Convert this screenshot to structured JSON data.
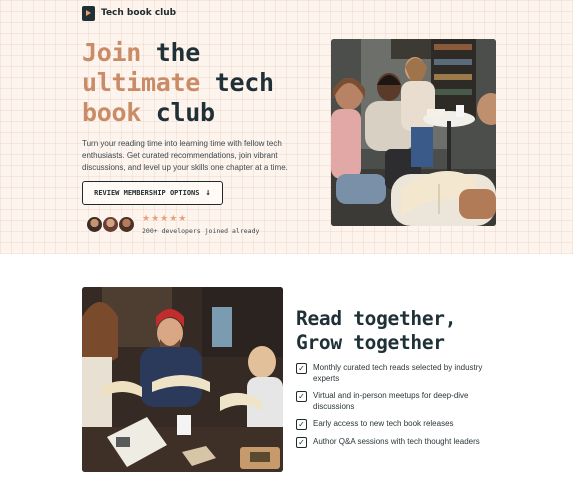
{
  "brand": {
    "name": "Tech book club",
    "logo_icon": "book-play-icon"
  },
  "hero": {
    "title_line1_accent": "Join",
    "title_line1_rest": " the",
    "title_line2_accent": "ultimate",
    "title_line2_rest": " tech",
    "title_line3_accent": "book",
    "title_line3_rest": " club",
    "description": "Turn your reading time into learning time with fellow tech enthusiasts. Get curated recommendations, join vibrant discussions, and level up your skills one chapter at a time.",
    "cta_label": "REVIEW MEMBERSHIP OPTIONS",
    "cta_icon": "arrow-down-icon",
    "stars": "★★★★★",
    "rating": 5,
    "joined_text": "200+ developers joined already"
  },
  "section2": {
    "title_line1": "Read together,",
    "title_line2": "Grow together",
    "features": [
      "Monthly curated tech reads selected by industry experts",
      "Virtual and in-person meetups for deep-dive discussions",
      "Early access to new tech book releases",
      "Author Q&A sessions with tech thought leaders"
    ]
  },
  "colors": {
    "accent": "#c98c67",
    "dark": "#1f3036",
    "hero_bg": "#fdf4ee",
    "star": "#e8a07a"
  }
}
